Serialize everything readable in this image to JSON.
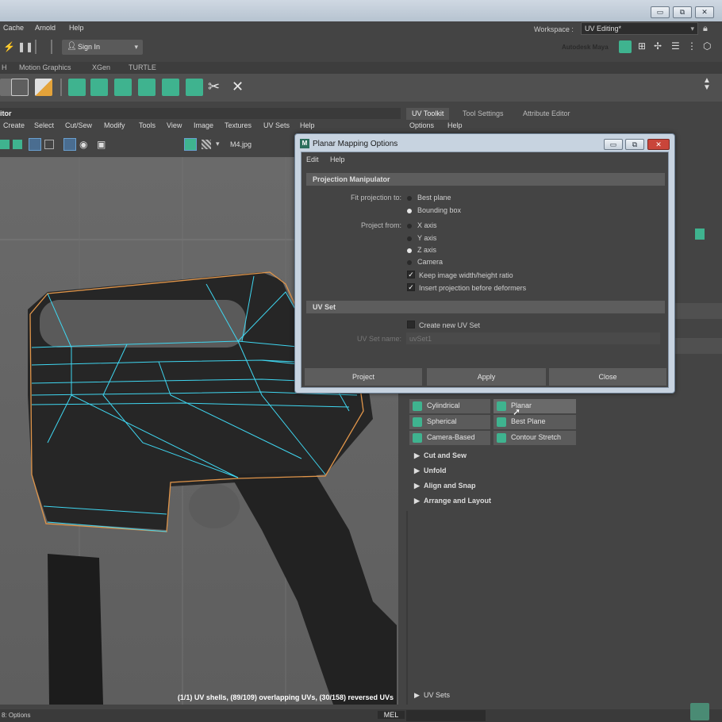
{
  "title_bar": {
    "buttons": [
      "▭",
      "⧉",
      "✕"
    ]
  },
  "menu": [
    "Cache",
    "Arnold",
    "Help"
  ],
  "workspace": {
    "label": "Workspace :",
    "value": "UV Editing*"
  },
  "status": {
    "sign_in": "Sign In",
    "brand": "Autodesk Maya"
  },
  "shelf_tabs": [
    "H",
    "Motion Graphics",
    "XGen",
    "TURTLE"
  ],
  "uv_editor": {
    "header": "itor",
    "menus": [
      "Create",
      "Select",
      "Cut/Sew",
      "Modify",
      "Tools",
      "View",
      "Image",
      "Textures",
      "UV Sets",
      "Help"
    ],
    "image_name": "M4.jpg",
    "status_message": "(1/1) UV shells, (89/109) overlapping UVs, (30/158) reversed UVs"
  },
  "right_panel": {
    "tabs": [
      "UV Toolkit",
      "Tool Settings",
      "Attribute Editor"
    ],
    "menus": [
      "Options",
      "Help"
    ],
    "create_buttons": [
      {
        "label": "Cylindrical"
      },
      {
        "label": "Planar"
      },
      {
        "label": "Spherical"
      },
      {
        "label": "Best Plane"
      },
      {
        "label": "Camera-Based"
      },
      {
        "label": "Contour Stretch"
      }
    ],
    "sections": [
      "Cut and Sew",
      "Unfold",
      "Align and Snap",
      "Arrange and Layout"
    ],
    "uv_sets_section": "UV Sets"
  },
  "help_line": {
    "text": "8: Options",
    "mel": "MEL"
  },
  "dialog": {
    "title": "Planar Mapping Options",
    "menus": [
      "Edit",
      "Help"
    ],
    "projection_header": "Projection Manipulator",
    "fit_label": "Fit projection to:",
    "fit_options": [
      {
        "label": "Best plane",
        "selected": false
      },
      {
        "label": "Bounding box",
        "selected": true
      }
    ],
    "project_from_label": "Project from:",
    "project_options": [
      {
        "label": "X axis",
        "selected": false
      },
      {
        "label": "Y axis",
        "selected": false
      },
      {
        "label": "Z axis",
        "selected": true
      },
      {
        "label": "Camera",
        "selected": false
      }
    ],
    "checks": [
      {
        "label": "Keep image width/height ratio",
        "checked": true
      },
      {
        "label": "Insert projection before deformers",
        "checked": true
      }
    ],
    "uvset_header": "UV Set",
    "create_new_uvset": {
      "label": "Create new UV Set",
      "checked": false
    },
    "uvset_name_label": "UV Set name:",
    "uvset_name_value": "uvSet1",
    "buttons": [
      "Project",
      "Apply",
      "Close"
    ]
  },
  "colors": {
    "uv_wire": "#3fd6f0",
    "shell_border": "#e0954a",
    "accent": "#3fb38f"
  }
}
